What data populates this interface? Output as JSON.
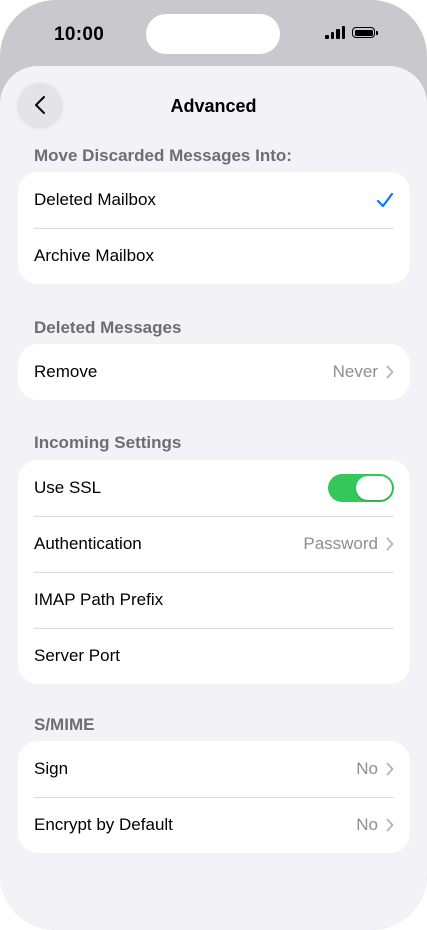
{
  "status_bar": {
    "time": "10:00"
  },
  "nav": {
    "title": "Advanced"
  },
  "sections": {
    "discarded": {
      "header": "Move Discarded Messages Into:",
      "items": [
        {
          "label": "Deleted Mailbox",
          "selected": true
        },
        {
          "label": "Archive Mailbox",
          "selected": false
        }
      ]
    },
    "deleted": {
      "header": "Deleted Messages",
      "remove": {
        "label": "Remove",
        "value": "Never"
      }
    },
    "incoming": {
      "header": "Incoming Settings",
      "use_ssl": {
        "label": "Use SSL",
        "on": true
      },
      "authentication": {
        "label": "Authentication",
        "value": "Password"
      },
      "imap_prefix": {
        "label": "IMAP Path Prefix"
      },
      "server_port": {
        "label": "Server Port"
      }
    },
    "smime": {
      "header": "S/MIME",
      "sign": {
        "label": "Sign",
        "value": "No"
      },
      "encrypt": {
        "label": "Encrypt by Default",
        "value": "No"
      }
    }
  },
  "colors": {
    "accent": "#007aff",
    "toggle_on": "#34c759",
    "secondary_text": "#8e8e93"
  },
  "icons": {
    "back": "chevron-left-icon",
    "disclosure": "chevron-right-icon",
    "selected": "checkmark-icon"
  }
}
